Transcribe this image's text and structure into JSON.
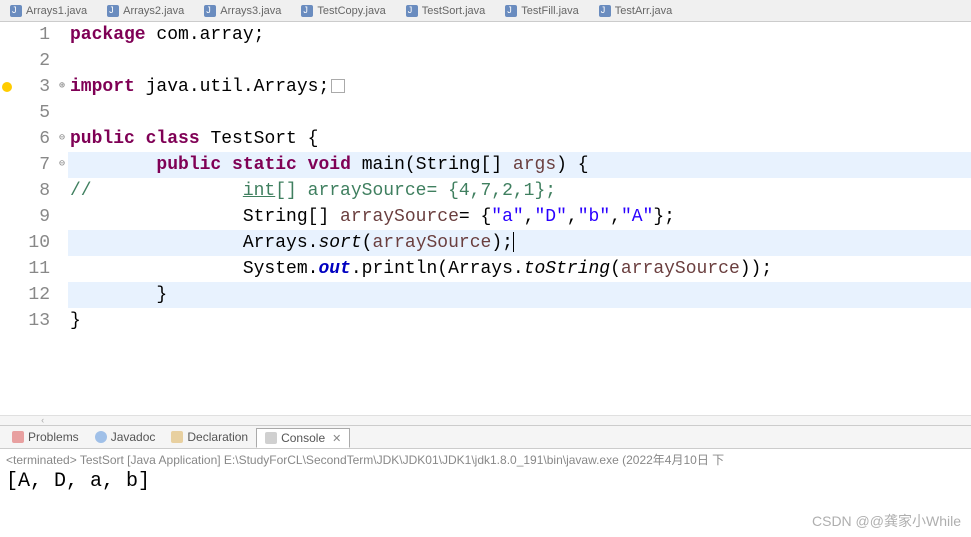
{
  "tabs": [
    {
      "name": "Arrays1.java"
    },
    {
      "name": "Arrays2.java"
    },
    {
      "name": "Arrays3.java"
    },
    {
      "name": "TestCopy.java"
    },
    {
      "name": "TestSort.java"
    },
    {
      "name": "TestFill.java"
    },
    {
      "name": "TestArr.java"
    }
  ],
  "code": {
    "line1_kw1": "package",
    "line1_rest": " com.array;",
    "line3_kw1": "import",
    "line3_rest": " java.util.Arrays;",
    "line6_kw1": "public",
    "line6_kw2": "class",
    "line6_name": " TestSort {",
    "line7_kw1": "public",
    "line7_kw2": "static",
    "line7_kw3": "void",
    "line7_main": " main(String[] ",
    "line7_args": "args",
    "line7_end": ") {",
    "line8_comment": "//\t\t",
    "line8_int": "int",
    "line8_rest": "[] arraySource= {4,7,2,1};",
    "line9_pre": "\t\tString[] ",
    "line9_var": "arraySource",
    "line9_eq": "= {",
    "line9_s1": "\"a\"",
    "line9_s2": "\"D\"",
    "line9_s3": "\"b\"",
    "line9_s4": "\"A\"",
    "line9_end": "};",
    "line10_pre": "\t\tArrays.",
    "line10_sort": "sort",
    "line10_open": "(",
    "line10_arg": "arraySource",
    "line10_end": ");",
    "line11_pre": "\t\tSystem.",
    "line11_out": "out",
    "line11_print": ".println(Arrays.",
    "line11_tostr": "toString",
    "line11_open": "(",
    "line11_arg": "arraySource",
    "line11_end": "));",
    "line12": "\t}",
    "line13": "}"
  },
  "gutter": [
    "1",
    "2",
    "3",
    "5",
    "6",
    "7",
    "8",
    "9",
    "10",
    "11",
    "12",
    "13"
  ],
  "fold": [
    "",
    "",
    "⊕",
    "",
    "⊖",
    "⊖",
    "",
    "",
    "",
    "",
    "",
    ""
  ],
  "views": {
    "problems": "Problems",
    "javadoc": "Javadoc",
    "declaration": "Declaration",
    "console": "Console"
  },
  "console": {
    "status": "<terminated> TestSort [Java Application] E:\\StudyForCL\\SecondTerm\\JDK\\JDK01\\JDK1\\jdk1.8.0_191\\bin\\javaw.exe (2022年4月10日 下",
    "output": "[A, D, a, b]"
  },
  "watermark": "CSDN @@龚家小While"
}
